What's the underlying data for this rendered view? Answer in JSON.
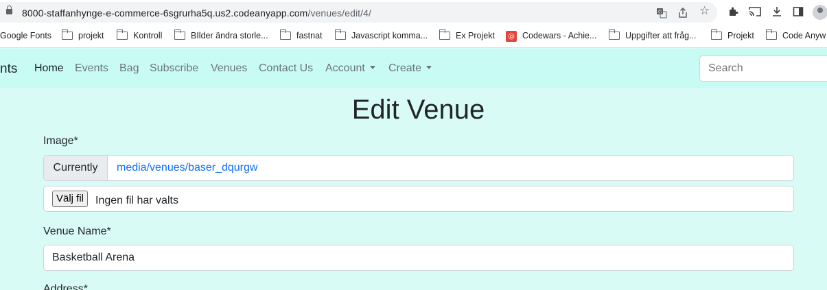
{
  "browser": {
    "url_host": "8000-staffanhynge-e-commerce-6sgrurha5q.us2.codeanyapp.com",
    "url_path": "/venues/edit/4/",
    "icons": [
      "lock-icon",
      "translate-icon",
      "share-icon",
      "star-icon",
      "extensions-icon",
      "cast-icon",
      "download-icon",
      "sidepanel-icon",
      "profile-icon"
    ]
  },
  "bookmarks": [
    {
      "label": "Google Fonts",
      "icon": "none"
    },
    {
      "label": "projekt",
      "icon": "folder-icon"
    },
    {
      "label": "Kontroll",
      "icon": "folder-icon"
    },
    {
      "label": "BIlder ändra storle...",
      "icon": "folder-icon"
    },
    {
      "label": "fastnat",
      "icon": "folder-icon"
    },
    {
      "label": "Javascript komma...",
      "icon": "folder-icon"
    },
    {
      "label": "Ex Projekt",
      "icon": "folder-icon"
    },
    {
      "label": "Codewars - Achie...",
      "icon": "codewars-icon"
    },
    {
      "label": "Uppgifter att fråg...",
      "icon": "folder-icon"
    },
    {
      "label": "Projekt",
      "icon": "folder-icon"
    },
    {
      "label": "Code Anyw",
      "icon": "folder-icon"
    }
  ],
  "navbar": {
    "brand": "nts",
    "links": [
      "Home",
      "Events",
      "Bag",
      "Subscribe",
      "Venues",
      "Contact Us"
    ],
    "dropdowns": [
      "Account",
      "Create"
    ],
    "search_placeholder": "Search"
  },
  "form": {
    "title": "Edit Venue",
    "image_label": "Image*",
    "currently_label": "Currently",
    "current_image": "media/venues/baser_dqurgw",
    "file_button": "Välj fil",
    "file_status": "Ingen fil har valts",
    "venue_name_label": "Venue Name*",
    "venue_name_value": "Basketball Arena",
    "address_label": "Address*"
  },
  "colors": {
    "page_bg": "#d9fbf6",
    "navbar_bg": "#c8fbf4",
    "link_blue": "#0d6efd"
  }
}
